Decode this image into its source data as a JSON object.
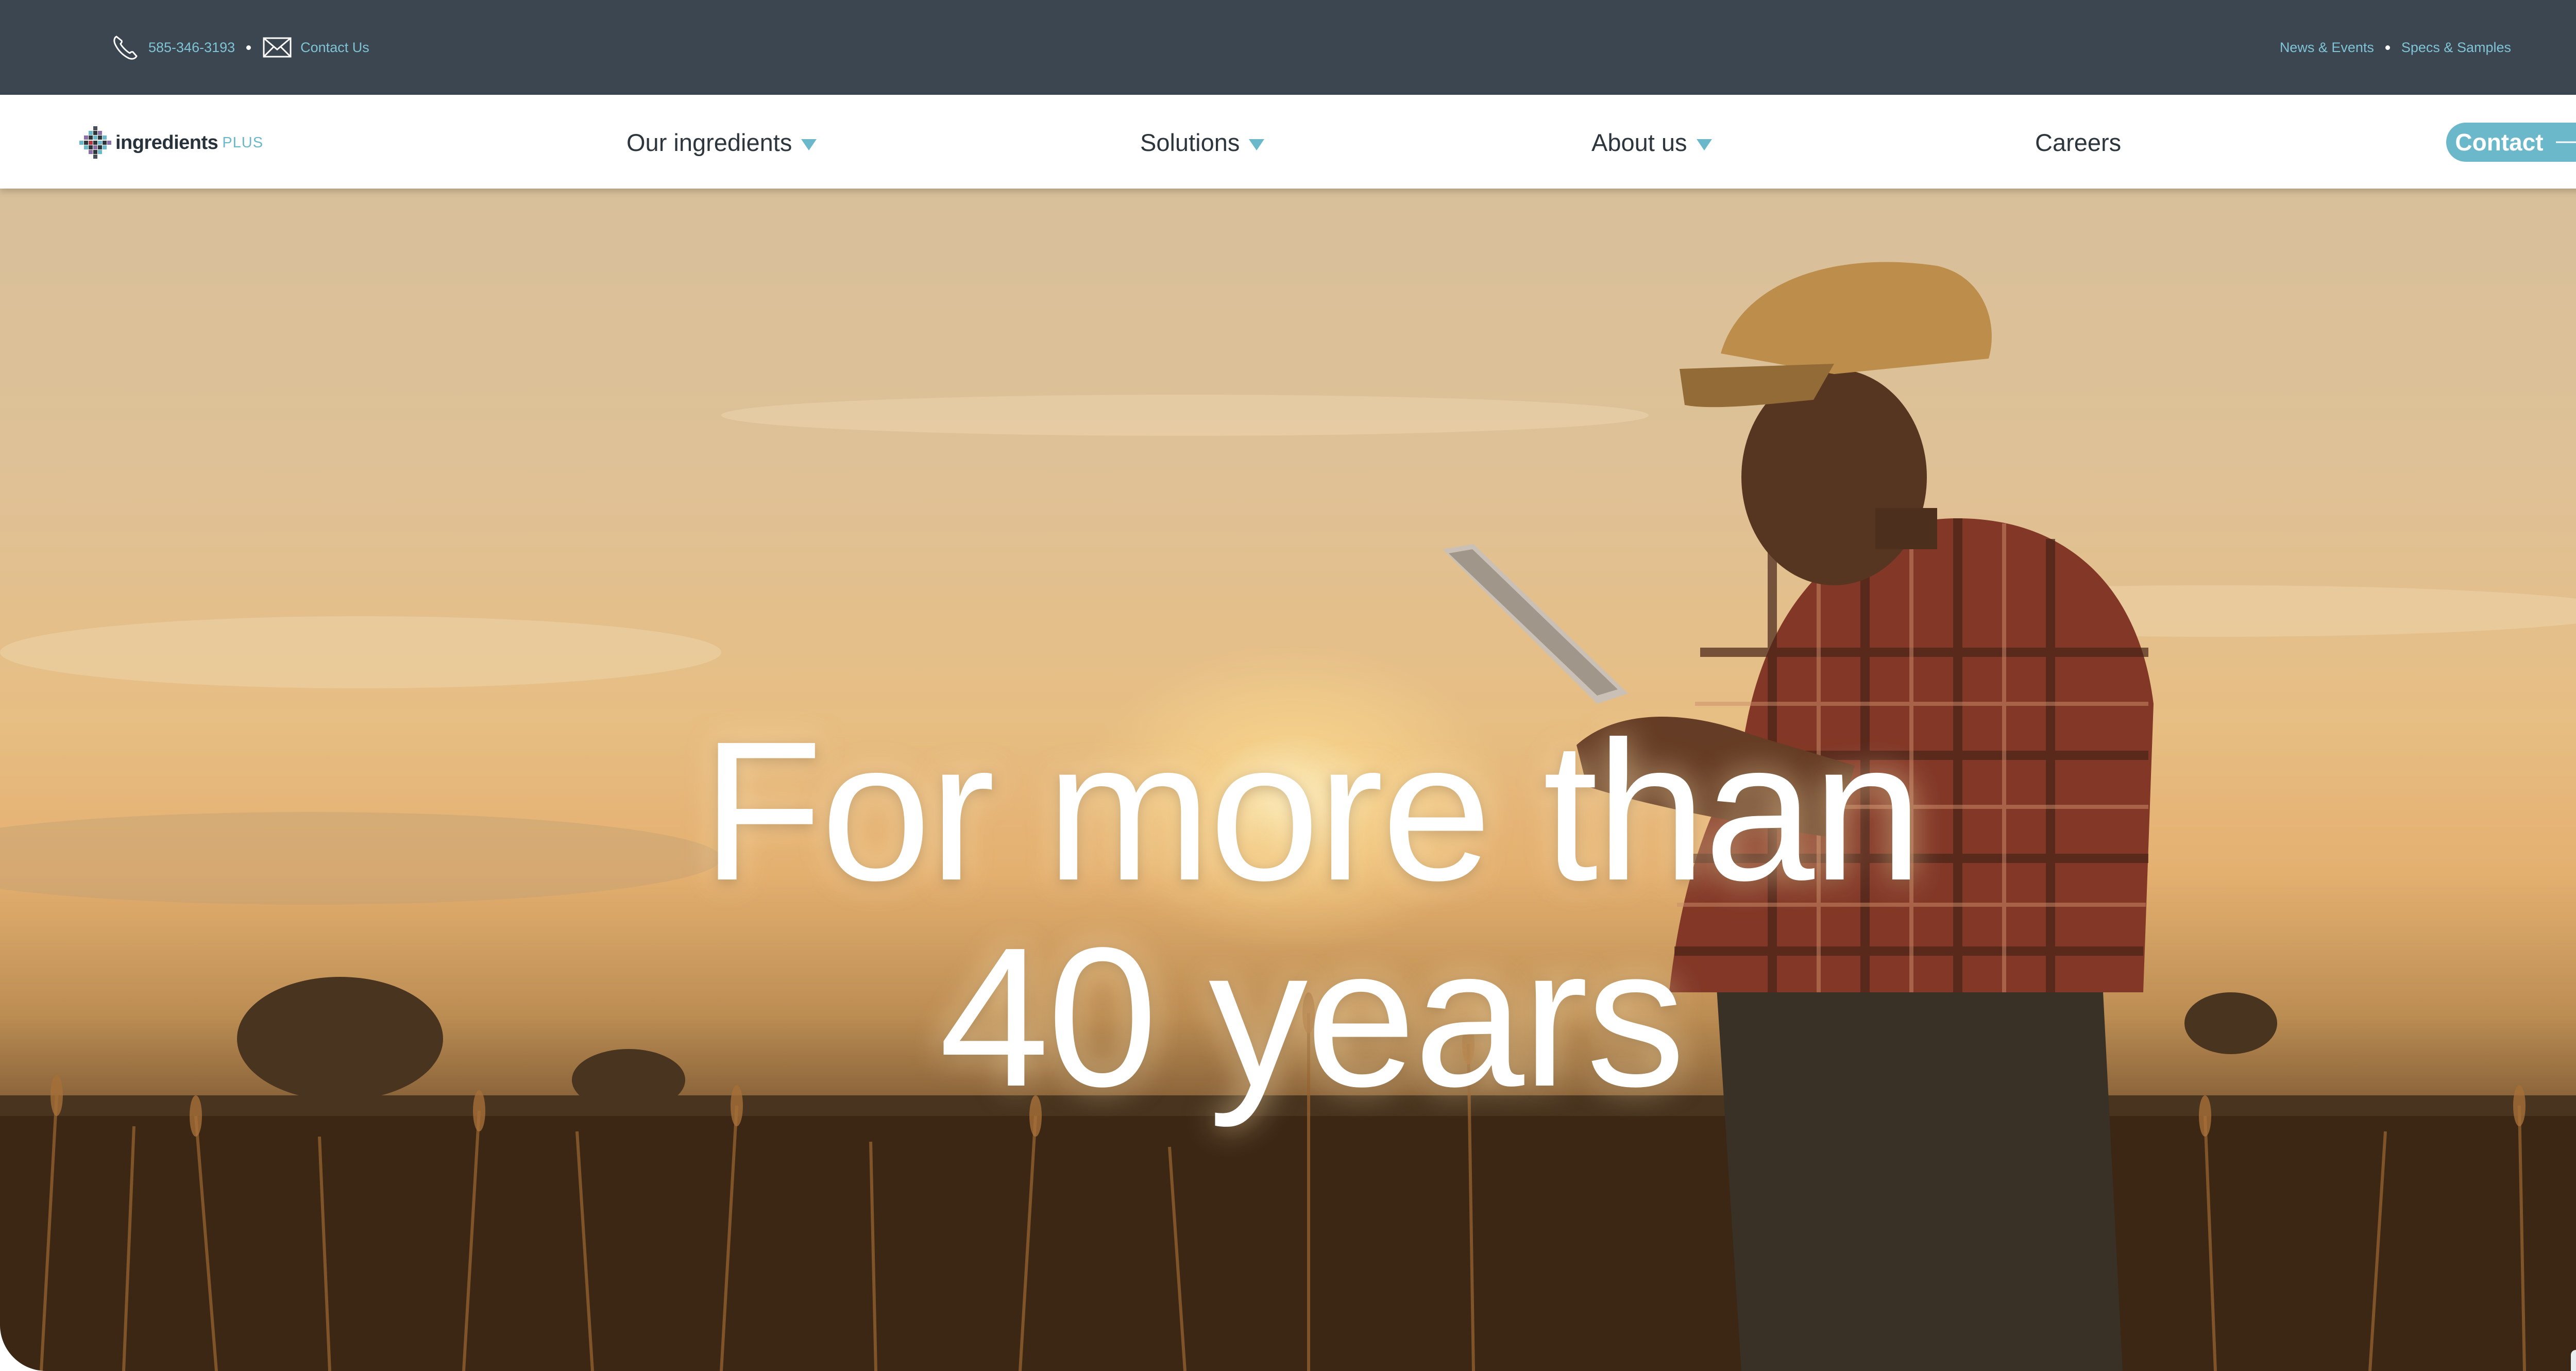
{
  "topbar": {
    "phone": "585-346-3193",
    "contact_link": "Contact Us",
    "news_link": "News & Events",
    "specs_link": "Specs & Samples"
  },
  "brand": {
    "name": "ingredients",
    "suffix": "PLUS"
  },
  "nav": {
    "items": [
      {
        "label": "Our ingredients",
        "has_dropdown": true
      },
      {
        "label": "Solutions",
        "has_dropdown": true
      },
      {
        "label": "About us",
        "has_dropdown": true
      },
      {
        "label": "Careers",
        "has_dropdown": false
      }
    ],
    "cta_label": "Contact"
  },
  "hero": {
    "line1": "For more than",
    "line2": "40 years"
  },
  "scroll_top_icon": "chevron-up-icon",
  "colors": {
    "topbar_bg": "#3b4650",
    "accent": "#6cb8cb",
    "nav_text": "#2d353d"
  }
}
